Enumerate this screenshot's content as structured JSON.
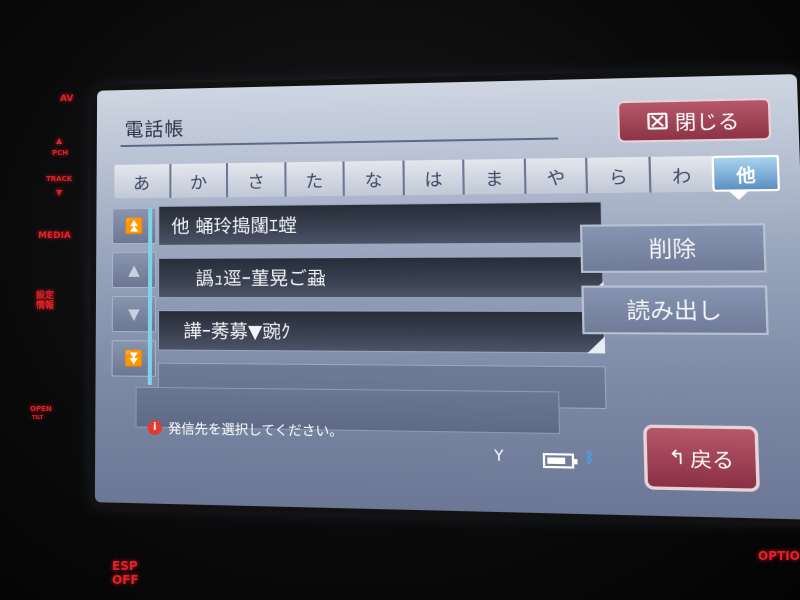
{
  "hardware": {
    "av_label": "AV",
    "pch_label": "PCH",
    "track_label": "TRACK",
    "media_label": "MEDIA",
    "settings_label": "設定\n情報",
    "open_label": "OPEN",
    "tilt_label": "TILT",
    "esp_label": "ESP",
    "esp_off_label": "OFF",
    "option_label": "OPTIO",
    "v_label": "V"
  },
  "screen": {
    "title": "電話帳",
    "close_button": "閉じる",
    "tabs": [
      "あ",
      "か",
      "さ",
      "た",
      "な",
      "は",
      "ま",
      "や",
      "ら",
      "わ",
      "他"
    ],
    "active_tab": "他",
    "scroll": {
      "top_icon": "double-up-icon",
      "up_icon": "up-icon",
      "down_icon": "down-icon",
      "bottom_icon": "double-down-icon"
    },
    "entries": [
      {
        "text": "他 蛹玲搗闥ｴ螳"
      },
      {
        "text": "譌ｭ逕ｰ菫晃ご蝨"
      },
      {
        "text": "譁ｰ莠募▼豌ｸ"
      }
    ],
    "delete_button": "削除",
    "read_button": "読み出し",
    "status_text": "発信先を選択してください。",
    "back_button": "戻る",
    "colors": {
      "accent_red": "#b5586a",
      "tab_active": "#5c8fc2",
      "bluetooth": "#45a3e8"
    }
  }
}
